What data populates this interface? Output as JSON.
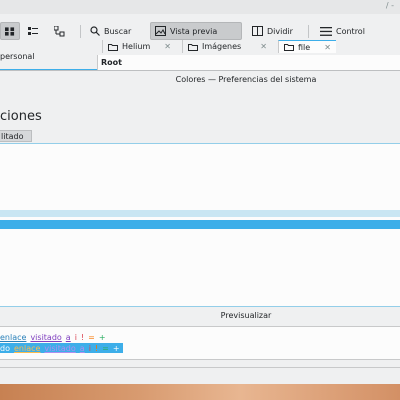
{
  "dolphin": {
    "title_hint": "/ -",
    "toolbar": {
      "search_label": "Buscar",
      "preview_label": "Vista previa",
      "split_label": "Dividir",
      "control_label": "Control"
    },
    "tabs": [
      {
        "label": "Helium"
      },
      {
        "label": "Imágenes"
      },
      {
        "label": "file"
      }
    ],
    "tab_close_glyph": "✕",
    "sidebar_label": "personal",
    "location_root": "Root"
  },
  "settings": {
    "title": "Colores  — Preferencias del sistema",
    "section_heading": "ciones",
    "section_tab": "litado",
    "preview_label": "Previsualizar",
    "preview": {
      "normal": {
        "prefix": "",
        "link": "enlace",
        "visited": "visitado",
        "a": "a",
        "i": "i",
        "excl": "!",
        "eq": "=",
        "plus": "+"
      },
      "selected": {
        "prefix": "do",
        "link": "enlace",
        "visited": "visitado",
        "a": "a",
        "i": "i",
        "excl": "!",
        "eq": "=",
        "plus": "+"
      }
    }
  },
  "colors": {
    "accent": "#3daee9",
    "window_bg": "#eff0f1",
    "view_bg": "#fcfcfc",
    "link": "#2980b9",
    "visited": "#7f3fbf",
    "negative": "#da4453",
    "neutral": "#f67400",
    "positive": "#27ae60"
  }
}
